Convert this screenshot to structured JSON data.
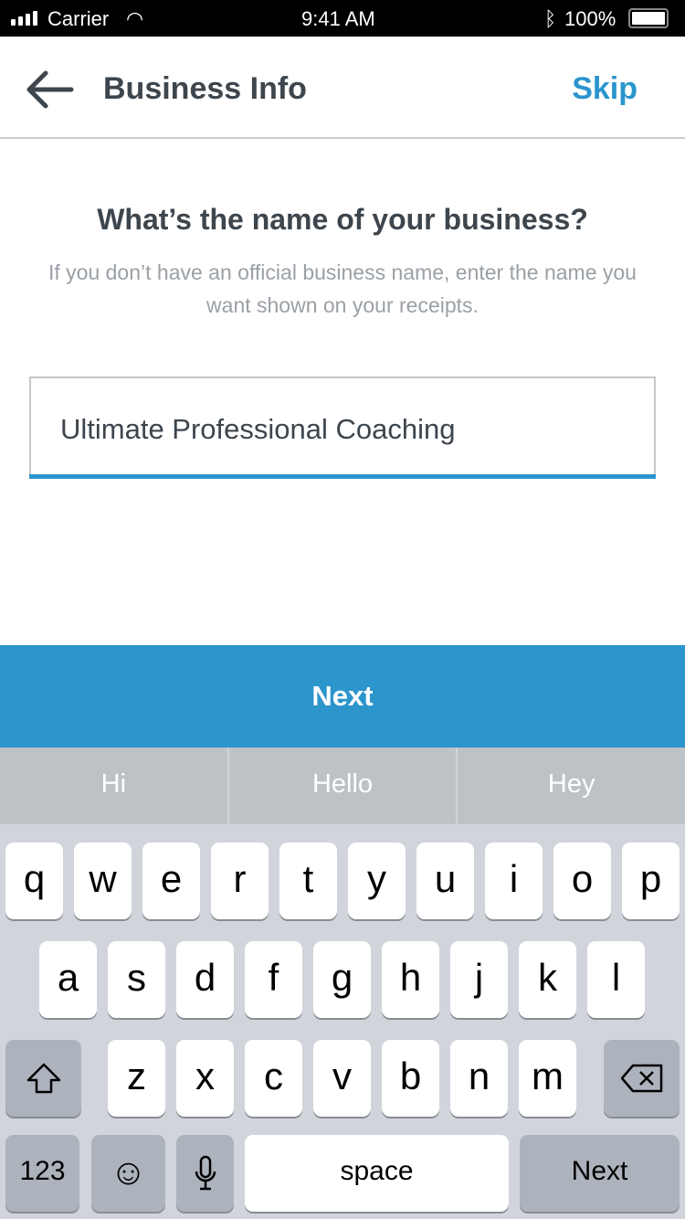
{
  "status": {
    "carrier": "Carrier",
    "time": "9:41 AM",
    "battery": "100%"
  },
  "nav": {
    "title": "Business Info",
    "skip": "Skip"
  },
  "main": {
    "question": "What’s the name of your business?",
    "hint": "If you don’t have an official business name, enter the name you want shown on your receipts.",
    "business_name": "Ultimate Professional Coaching"
  },
  "next_button": "Next",
  "suggestions": [
    "Hi",
    "Hello",
    "Hey"
  ],
  "keyboard": {
    "row1": [
      "q",
      "w",
      "e",
      "r",
      "t",
      "y",
      "u",
      "i",
      "o",
      "p"
    ],
    "row2": [
      "a",
      "s",
      "d",
      "f",
      "g",
      "h",
      "j",
      "k",
      "l"
    ],
    "row3": [
      "z",
      "x",
      "c",
      "v",
      "b",
      "n",
      "m"
    ],
    "numbers": "123",
    "space": "space",
    "return": "Next"
  },
  "colors": {
    "accent": "#2b95cc",
    "text": "#3d454d"
  }
}
